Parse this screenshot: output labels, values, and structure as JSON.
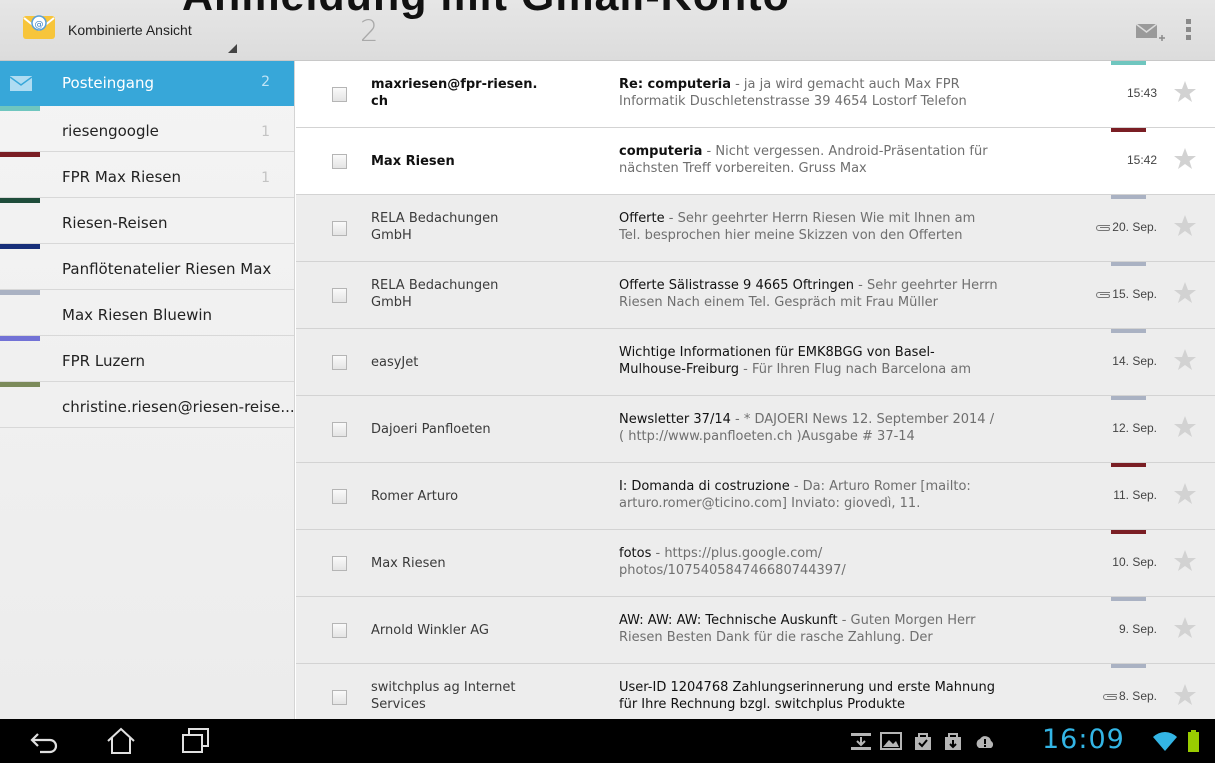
{
  "overlay_title": "Anmeldung mit Gmail-Konto",
  "header": {
    "account_label": "Kombinierte Ansicht",
    "unread_count": "2"
  },
  "sidebar": {
    "items": [
      {
        "label": "Posteingang",
        "count": "2",
        "color": "#37a7d9",
        "active": true
      },
      {
        "label": "riesengoogle",
        "count": "1",
        "color": "#6fc6bf"
      },
      {
        "label": "FPR Max Riesen",
        "count": "1",
        "color": "#7a1e24"
      },
      {
        "label": "Riesen-Reisen",
        "count": "",
        "color": "#1f4d3b"
      },
      {
        "label": "Panflötenatelier Riesen Max",
        "count": "",
        "color": "#172f7a"
      },
      {
        "label": "Max Riesen Bluewin",
        "count": "",
        "color": "#aab2c3"
      },
      {
        "label": "FPR Luzern",
        "count": "",
        "color": "#7272d6"
      },
      {
        "label": "christine.riesen@riesen-reise...",
        "count": "",
        "color": "#7b8a5a"
      }
    ]
  },
  "messages": [
    {
      "sender": "maxriesen@fpr-riesen.\nch",
      "subject": "Re: computeria",
      "snippet": " - ja ja wird gemacht auch Max FPR Informatik Duschletenstrasse 39 4654 Lostorf Telefon",
      "date": "15:43",
      "attachment": false,
      "unread": true,
      "account_color": "#6fc6bf"
    },
    {
      "sender": "Max Riesen",
      "subject": "computeria",
      "snippet": " - Nicht vergessen. Android-Präsentation für nächsten Treff vorbereiten. Gruss Max",
      "date": "15:42",
      "attachment": false,
      "unread": true,
      "account_color": "#7a1e24"
    },
    {
      "sender": "RELA Bedachungen\nGmbH",
      "subject": "Offerte",
      "snippet": " - Sehr geehrter Herrn Riesen Wie mit Ihnen am Tel. besprochen hier meine Skizzen von den Offerten",
      "date": "20. Sep.",
      "attachment": true,
      "unread": false,
      "account_color": "#aab2c3"
    },
    {
      "sender": "RELA Bedachungen\nGmbH",
      "subject": "Offerte Sälistrasse 9 4665 Oftringen",
      "snippet": " - Sehr geehrter Herrn Riesen Nach einem Tel. Gespräch mit Frau Müller",
      "date": "15. Sep.",
      "attachment": true,
      "unread": false,
      "account_color": "#aab2c3"
    },
    {
      "sender": "easyJet",
      "subject": "Wichtige Informationen für EMK8BGG von Basel-Mulhouse-Freiburg",
      "snippet": " - Für Ihren Flug nach Barcelona am",
      "date": "14. Sep.",
      "attachment": false,
      "unread": false,
      "account_color": "#aab2c3"
    },
    {
      "sender": "Dajoeri Panfloeten",
      "subject": "Newsletter 37/14",
      "snippet": " - * DAJOERI News 12. September 2014 / ( http://www.panfloeten.ch )Ausgabe # 37-14",
      "date": "12. Sep.",
      "attachment": false,
      "unread": false,
      "account_color": "#aab2c3"
    },
    {
      "sender": "Romer Arturo",
      "subject": "I: Domanda di costruzione",
      "snippet": " - Da: Arturo Romer [mailto: arturo.romer@ticino.com] Inviato: giovedì, 11.",
      "date": "11. Sep.",
      "attachment": false,
      "unread": false,
      "account_color": "#7a1e24"
    },
    {
      "sender": "Max Riesen",
      "subject": "fotos",
      "snippet": " - https://plus.google.com/ photos/107540584746680744397/",
      "date": "10. Sep.",
      "attachment": false,
      "unread": false,
      "account_color": "#7a1e24"
    },
    {
      "sender": "Arnold Winkler AG",
      "subject": "AW: AW: AW: Technische Auskunft",
      "snippet": " - Guten Morgen Herr Riesen Besten Dank für die rasche Zahlung. Der",
      "date": "9. Sep.",
      "attachment": false,
      "unread": false,
      "account_color": "#aab2c3"
    },
    {
      "sender": "switchplus ag Internet\nServices",
      "subject": "User-ID 1204768 Zahlungserinnerung und erste Mahnung für Ihre Rechnung bzgl. switchplus Produkte",
      "snippet": "",
      "date": "8. Sep.",
      "attachment": true,
      "unread": false,
      "account_color": "#aab2c3"
    }
  ],
  "statusbar": {
    "clock": "16:09"
  },
  "colors": {
    "accent": "#37a7d9",
    "clock": "#33b5e5"
  }
}
